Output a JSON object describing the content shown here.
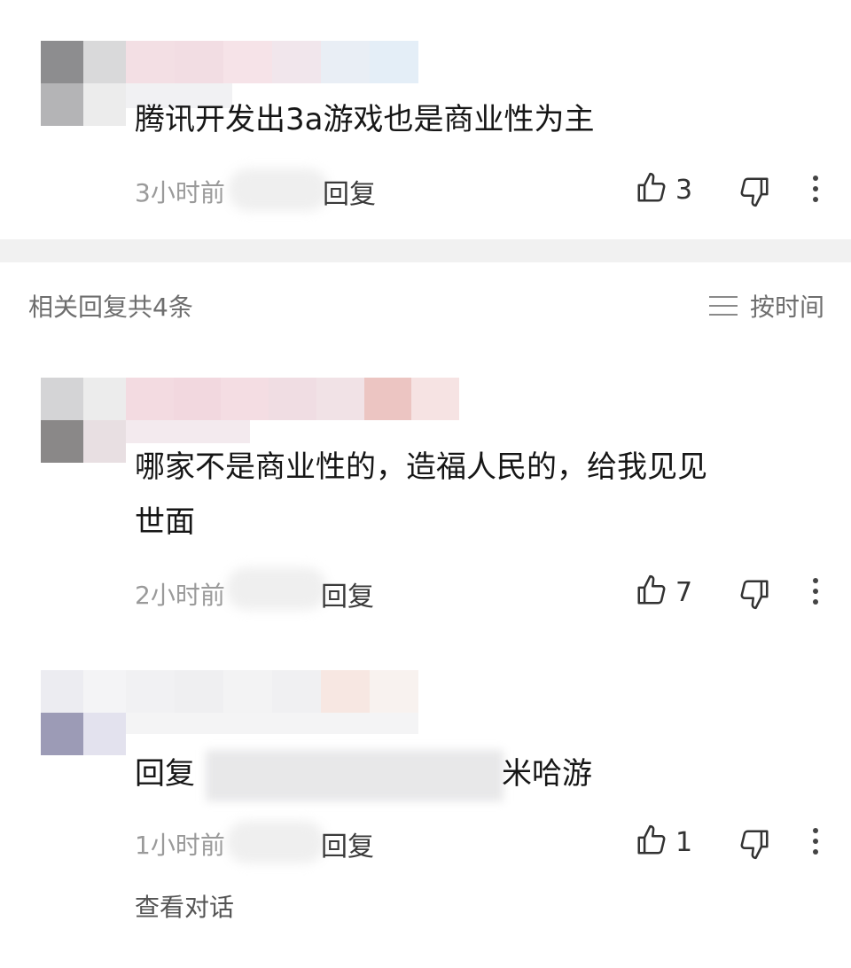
{
  "main_comment": {
    "text": "腾讯开发出3a游戏也是商业性为主",
    "time": "3小时前",
    "reply_label": "回复",
    "like_count": "3"
  },
  "replies_section": {
    "title": "相关回复共4条",
    "sort_label": "按时间"
  },
  "replies": [
    {
      "text_line1": "哪家不是商业性的，造福人民的，给我见见",
      "text_line2": "世面",
      "time": "2小时前",
      "reply_label": "回复",
      "like_count": "7"
    },
    {
      "text_prefix": "回复",
      "text_suffix": "米哈游",
      "time": "1小时前",
      "reply_label": "回复",
      "like_count": "1",
      "view_conversation": "查看对话"
    }
  ],
  "icons": {
    "like": "thumbs-up-icon",
    "dislike": "thumbs-down-icon",
    "more": "more-vertical-icon",
    "sort": "hamburger-icon"
  },
  "colors": {
    "text_primary": "#161616",
    "text_meta": "#9a9a9a",
    "divider": "#f1f1f1"
  }
}
